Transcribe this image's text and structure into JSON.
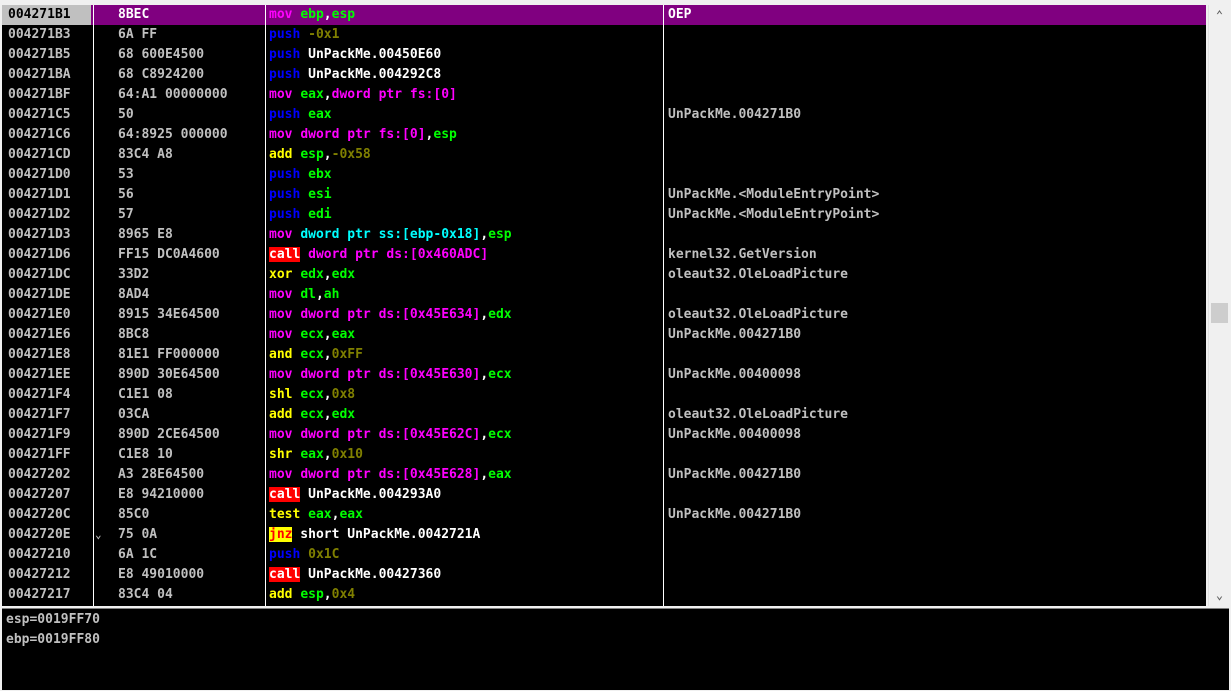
{
  "colors": {
    "mov": "#ff00ff",
    "push": "#0000ff",
    "call_bg": "#ff0000",
    "jcc_bg": "#ffff00",
    "arith": "#ffff00",
    "number": "#808000",
    "register": "#00ff00",
    "memory": "#00ffff",
    "selection": "#800080"
  },
  "disassembly": [
    {
      "addr": "004271B1",
      "bytes": "8BEC",
      "dis": [
        [
          "mov ",
          "mov"
        ],
        [
          "ebp",
          "reg"
        ],
        [
          ",",
          ""
        ],
        [
          "esp",
          "reg"
        ]
      ],
      "comment": "OEP",
      "selected": true
    },
    {
      "addr": "004271B3",
      "bytes": "6A FF",
      "dis": [
        [
          "push ",
          "push"
        ],
        [
          "-0x1",
          "num"
        ]
      ],
      "comment": ""
    },
    {
      "addr": "004271B5",
      "bytes": "68 600E4500",
      "dis": [
        [
          "push ",
          "push"
        ],
        [
          "UnPackMe.00450E60",
          "plain"
        ]
      ],
      "comment": ""
    },
    {
      "addr": "004271BA",
      "bytes": "68 C8924200",
      "dis": [
        [
          "push ",
          "push"
        ],
        [
          "UnPackMe.004292C8",
          "plain"
        ]
      ],
      "comment": ""
    },
    {
      "addr": "004271BF",
      "bytes": "64:A1 00000000",
      "dis": [
        [
          "mov ",
          "mov"
        ],
        [
          "eax",
          "reg"
        ],
        [
          ",",
          ""
        ],
        [
          "dword ptr fs:[0]",
          "memmov"
        ]
      ],
      "comment": ""
    },
    {
      "addr": "004271C5",
      "bytes": "50",
      "dis": [
        [
          "push ",
          "push"
        ],
        [
          "eax",
          "reg"
        ]
      ],
      "comment": "UnPackMe.004271B0"
    },
    {
      "addr": "004271C6",
      "bytes": "64:8925 000000",
      "dis": [
        [
          "mov ",
          "mov"
        ],
        [
          "dword ptr fs:[0]",
          "memmov"
        ],
        [
          ",",
          ""
        ],
        [
          "esp",
          "reg"
        ]
      ],
      "comment": ""
    },
    {
      "addr": "004271CD",
      "bytes": "83C4 A8",
      "dis": [
        [
          "add ",
          "arith"
        ],
        [
          "esp",
          "reg"
        ],
        [
          ",",
          ""
        ],
        [
          "-0x58",
          "num"
        ]
      ],
      "comment": ""
    },
    {
      "addr": "004271D0",
      "bytes": "53",
      "dis": [
        [
          "push ",
          "push"
        ],
        [
          "ebx",
          "reg"
        ]
      ],
      "comment": ""
    },
    {
      "addr": "004271D1",
      "bytes": "56",
      "dis": [
        [
          "push ",
          "push"
        ],
        [
          "esi",
          "reg"
        ]
      ],
      "comment": "UnPackMe.<ModuleEntryPoint>"
    },
    {
      "addr": "004271D2",
      "bytes": "57",
      "dis": [
        [
          "push ",
          "push"
        ],
        [
          "edi",
          "reg"
        ]
      ],
      "comment": "UnPackMe.<ModuleEntryPoint>"
    },
    {
      "addr": "004271D3",
      "bytes": "8965 E8",
      "dis": [
        [
          "mov ",
          "mov"
        ],
        [
          "dword ptr ss:[ebp-0x18]",
          "mem"
        ],
        [
          ",",
          ""
        ],
        [
          "esp",
          "reg"
        ]
      ],
      "comment": ""
    },
    {
      "addr": "004271D6",
      "bytes": "FF15 DC0A4600",
      "dis": [
        [
          "call",
          "call"
        ],
        [
          " ",
          ""
        ],
        [
          "dword ptr ds:[0x460ADC]",
          "memmov"
        ]
      ],
      "comment": "kernel32.GetVersion"
    },
    {
      "addr": "004271DC",
      "bytes": "33D2",
      "dis": [
        [
          "xor ",
          "arith"
        ],
        [
          "edx",
          "reg"
        ],
        [
          ",",
          ""
        ],
        [
          "edx",
          "reg"
        ]
      ],
      "comment": "oleaut32.OleLoadPicture"
    },
    {
      "addr": "004271DE",
      "bytes": "8AD4",
      "dis": [
        [
          "mov ",
          "mov"
        ],
        [
          "dl",
          "reg"
        ],
        [
          ",",
          ""
        ],
        [
          "ah",
          "reg"
        ]
      ],
      "comment": ""
    },
    {
      "addr": "004271E0",
      "bytes": "8915 34E64500",
      "dis": [
        [
          "mov ",
          "mov"
        ],
        [
          "dword ptr ds:[0x45E634]",
          "memmov"
        ],
        [
          ",",
          ""
        ],
        [
          "edx",
          "reg"
        ]
      ],
      "comment": "oleaut32.OleLoadPicture"
    },
    {
      "addr": "004271E6",
      "bytes": "8BC8",
      "dis": [
        [
          "mov ",
          "mov"
        ],
        [
          "ecx",
          "reg"
        ],
        [
          ",",
          ""
        ],
        [
          "eax",
          "reg"
        ]
      ],
      "comment": "UnPackMe.004271B0"
    },
    {
      "addr": "004271E8",
      "bytes": "81E1 FF000000",
      "dis": [
        [
          "and ",
          "arith"
        ],
        [
          "ecx",
          "reg"
        ],
        [
          ",",
          ""
        ],
        [
          "0xFF",
          "num"
        ]
      ],
      "comment": ""
    },
    {
      "addr": "004271EE",
      "bytes": "890D 30E64500",
      "dis": [
        [
          "mov ",
          "mov"
        ],
        [
          "dword ptr ds:[0x45E630]",
          "memmov"
        ],
        [
          ",",
          ""
        ],
        [
          "ecx",
          "reg"
        ]
      ],
      "comment": "UnPackMe.00400098"
    },
    {
      "addr": "004271F4",
      "bytes": "C1E1 08",
      "dis": [
        [
          "shl ",
          "arith"
        ],
        [
          "ecx",
          "reg"
        ],
        [
          ",",
          ""
        ],
        [
          "0x8",
          "num"
        ]
      ],
      "comment": ""
    },
    {
      "addr": "004271F7",
      "bytes": "03CA",
      "dis": [
        [
          "add ",
          "arith"
        ],
        [
          "ecx",
          "reg"
        ],
        [
          ",",
          ""
        ],
        [
          "edx",
          "reg"
        ]
      ],
      "comment": "oleaut32.OleLoadPicture"
    },
    {
      "addr": "004271F9",
      "bytes": "890D 2CE64500",
      "dis": [
        [
          "mov ",
          "mov"
        ],
        [
          "dword ptr ds:[0x45E62C]",
          "memmov"
        ],
        [
          ",",
          ""
        ],
        [
          "ecx",
          "reg"
        ]
      ],
      "comment": "UnPackMe.00400098"
    },
    {
      "addr": "004271FF",
      "bytes": "C1E8 10",
      "dis": [
        [
          "shr ",
          "arith"
        ],
        [
          "eax",
          "reg"
        ],
        [
          ",",
          ""
        ],
        [
          "0x10",
          "num"
        ]
      ],
      "comment": ""
    },
    {
      "addr": "00427202",
      "bytes": "A3 28E64500",
      "dis": [
        [
          "mov ",
          "mov"
        ],
        [
          "dword ptr ds:[0x45E628]",
          "memmov"
        ],
        [
          ",",
          ""
        ],
        [
          "eax",
          "reg"
        ]
      ],
      "comment": "UnPackMe.004271B0"
    },
    {
      "addr": "00427207",
      "bytes": "E8 94210000",
      "dis": [
        [
          "call",
          "call"
        ],
        [
          " ",
          ""
        ],
        [
          "UnPackMe.004293A0",
          "plain"
        ]
      ],
      "comment": ""
    },
    {
      "addr": "0042720C",
      "bytes": "85C0",
      "dis": [
        [
          "test ",
          "arith"
        ],
        [
          "eax",
          "reg"
        ],
        [
          ",",
          ""
        ],
        [
          "eax",
          "reg"
        ]
      ],
      "comment": "UnPackMe.004271B0"
    },
    {
      "addr": "0042720E",
      "bytes": "75 0A",
      "dis": [
        [
          "jnz",
          "jcc"
        ],
        [
          " short ",
          ""
        ],
        [
          "UnPackMe.0042721A",
          "plain"
        ]
      ],
      "comment": "",
      "jump": true
    },
    {
      "addr": "00427210",
      "bytes": "6A 1C",
      "dis": [
        [
          "push ",
          "push"
        ],
        [
          "0x1C",
          "num"
        ]
      ],
      "comment": ""
    },
    {
      "addr": "00427212",
      "bytes": "E8 49010000",
      "dis": [
        [
          "call",
          "call"
        ],
        [
          " ",
          ""
        ],
        [
          "UnPackMe.00427360",
          "plain"
        ]
      ],
      "comment": ""
    },
    {
      "addr": "00427217",
      "bytes": "83C4 04",
      "dis": [
        [
          "add ",
          "arith"
        ],
        [
          "esp",
          "reg"
        ],
        [
          ",",
          ""
        ],
        [
          "0x4",
          "num"
        ]
      ],
      "comment": ""
    }
  ],
  "info": {
    "line1": "esp=0019FF70",
    "line2": "ebp=0019FF80"
  },
  "scrollbar": {
    "up_icon": "chevron-up-icon",
    "down_icon": "chevron-down-icon",
    "up_glyph": "⌃",
    "down_glyph": "⌄",
    "position": 0.5
  }
}
